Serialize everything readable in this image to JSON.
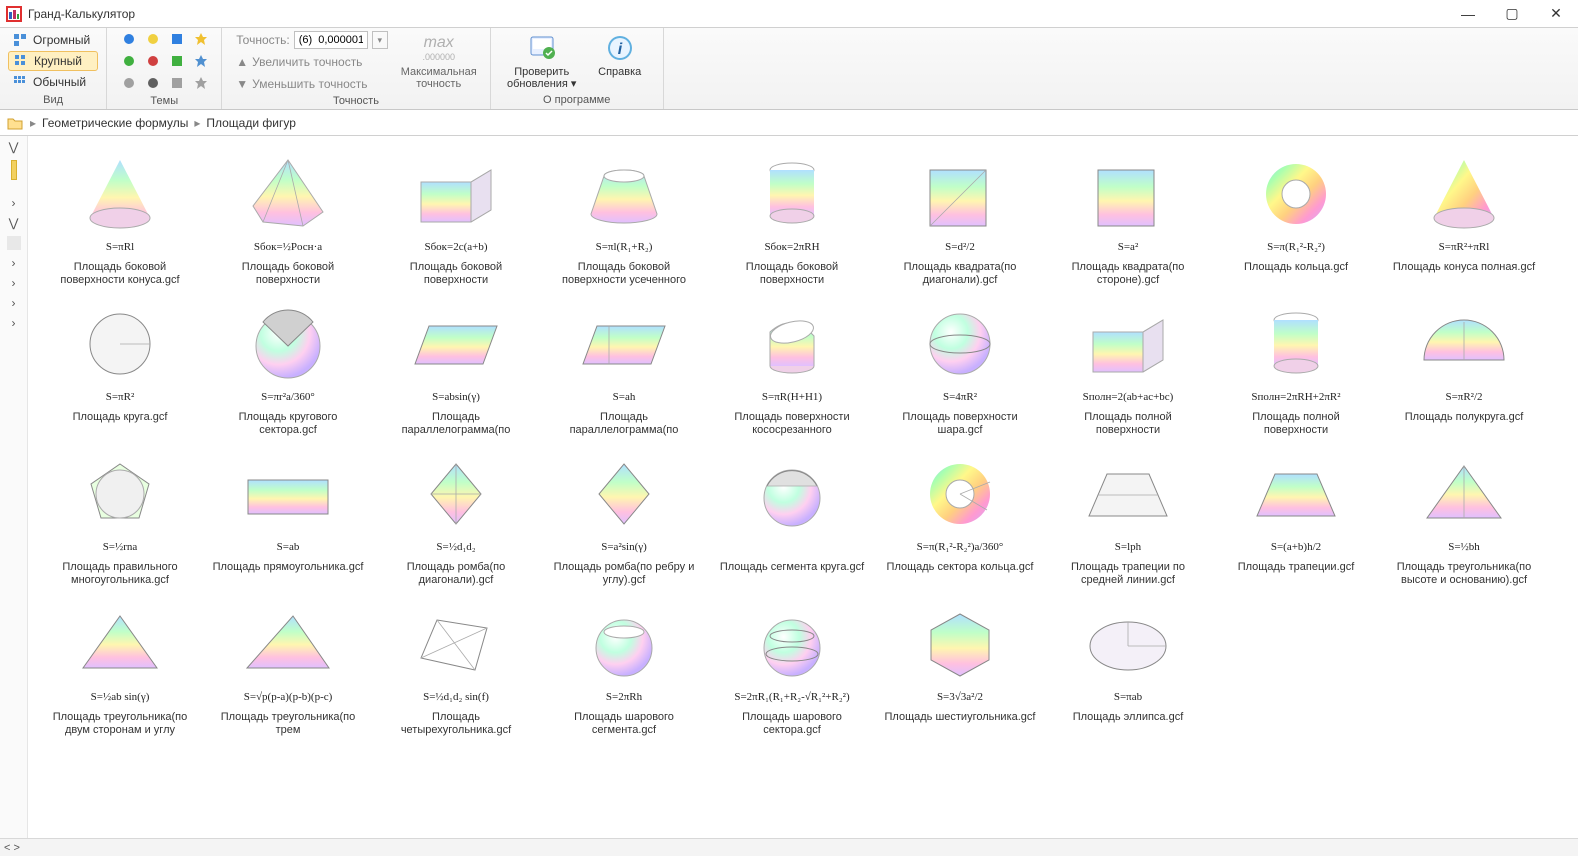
{
  "app": {
    "title": "Гранд-Калькулятор"
  },
  "window": {
    "min": "—",
    "max": "▢",
    "close": "✕"
  },
  "ribbon": {
    "view": {
      "label": "Вид",
      "huge": "Огромный",
      "large": "Крупный",
      "normal": "Обычный"
    },
    "themes": {
      "label": "Темы"
    },
    "precision": {
      "label": "Точность",
      "prec_label": "Точность:",
      "prec_value": "(6)  0,000001",
      "inc": "Увеличить точность",
      "dec": "Уменьшить точность",
      "max_top": "max",
      "max_sub": ".000000",
      "max_label": "Максимальная точность"
    },
    "about": {
      "label": "О программе",
      "check": "Проверить обновления",
      "help": "Справка"
    }
  },
  "breadcrumb": {
    "l1": "Геометрические формулы",
    "l2": "Площади фигур"
  },
  "tiles": [
    {
      "shape": "cone",
      "formula": "S=πRl",
      "caption": "Площадь боковой поверхности конуса.gcf"
    },
    {
      "shape": "pyramid",
      "formula": "Sбок=½Pосн·a",
      "caption": "Площадь боковой поверхности"
    },
    {
      "shape": "prism",
      "formula": "Sбок=2c(a+b)",
      "caption": "Площадь боковой поверхности"
    },
    {
      "shape": "frustum-cone",
      "formula": "S=πl(R₁+R₂)",
      "caption": "Площадь боковой поверхности усеченного"
    },
    {
      "shape": "cylinder",
      "formula": "Sбок=2πRH",
      "caption": "Площадь боковой поверхности"
    },
    {
      "shape": "square-diag",
      "formula": "S=d²/2",
      "caption": "Площадь квадрата(по диагонали).gcf"
    },
    {
      "shape": "square",
      "formula": "S=a²",
      "caption": "Площадь квадрата(по стороне).gcf"
    },
    {
      "shape": "annulus",
      "formula": "S=π(R₁²-R₂²)",
      "caption": "Площадь кольца.gcf"
    },
    {
      "shape": "cone-full",
      "formula": "S=πR²+πRl",
      "caption": "Площадь конуса полная.gcf"
    },
    {
      "shape": "circle",
      "formula": "S=πR²",
      "caption": "Площадь круга.gcf"
    },
    {
      "shape": "sector",
      "formula": "S=πr²a/360°",
      "caption": "Площадь кругового сектора.gcf"
    },
    {
      "shape": "parallelogram",
      "formula": "S=absin(γ)",
      "caption": "Площадь параллелограмма(по"
    },
    {
      "shape": "parallelogram-h",
      "formula": "S=ah",
      "caption": "Площадь параллелограмма(по"
    },
    {
      "shape": "sliced-cyl",
      "formula": "S=πR(H+H1)",
      "caption": "Площадь поверхности кососрезанного"
    },
    {
      "shape": "sphere",
      "formula": "S=4πR²",
      "caption": "Площадь поверхности шара.gcf"
    },
    {
      "shape": "box",
      "formula": "Sполн=2(ab+ac+bc)",
      "caption": "Площадь полной поверхности"
    },
    {
      "shape": "cylinder-full",
      "formula": "Sполн=2πRH+2πR²",
      "caption": "Площадь полной поверхности"
    },
    {
      "shape": "semicircle",
      "formula": "S=πR²/2",
      "caption": "Площадь полукруга.gcf"
    },
    {
      "shape": "polygon",
      "formula": "S=½rna",
      "caption": "Площадь правильного многоугольника.gcf"
    },
    {
      "shape": "rectangle",
      "formula": "S=ab",
      "caption": "Площадь прямоугольника.gcf"
    },
    {
      "shape": "rhombus-d",
      "formula": "S=½d₁d₂",
      "caption": "Площадь ромба(по диагонали).gcf"
    },
    {
      "shape": "rhombus",
      "formula": "S=a²sin(γ)",
      "caption": "Площадь ромба(по ребру и углу).gcf"
    },
    {
      "shape": "segment",
      "formula": "",
      "caption": "Площадь сегмента круга.gcf"
    },
    {
      "shape": "ring-sector",
      "formula": "S=π(R₁²-R₂²)a/360°",
      "caption": "Площадь сектора кольца.gcf"
    },
    {
      "shape": "trapezoid-m",
      "formula": "S=lph",
      "caption": "Площадь трапеции по средней линии.gcf"
    },
    {
      "shape": "trapezoid",
      "formula": "S=(a+b)h/2",
      "caption": "Площадь трапеции.gcf"
    },
    {
      "shape": "triangle-bh",
      "formula": "S=½bh",
      "caption": "Площадь треугольника(по высоте и основанию).gcf"
    },
    {
      "shape": "triangle-ab",
      "formula": "S=½ab sin(γ)",
      "caption": "Площадь треугольника(по двум сторонам и углу"
    },
    {
      "shape": "triangle-3",
      "formula": "S=√p(p-a)(p-b)(p-c)",
      "caption": "Площадь треугольника(по трем"
    },
    {
      "shape": "quad",
      "formula": "S=½d₁d₂ sin(f)",
      "caption": "Площадь четырехугольника.gcf"
    },
    {
      "shape": "sphere-seg",
      "formula": "S=2πRh",
      "caption": "Площадь шарового сегмента.gcf"
    },
    {
      "shape": "sphere-sec",
      "formula": "S=2πR₁(R₁+R₂-√R₁²+R₂²)",
      "caption": "Площадь шарового сектора.gcf"
    },
    {
      "shape": "hexagon",
      "formula": "S=3√3a²/2",
      "caption": "Площадь шестиугольника.gcf"
    },
    {
      "shape": "ellipse",
      "formula": "S=πab",
      "caption": "Площадь эллипса.gcf"
    }
  ],
  "status": {
    "nav": "< >"
  }
}
